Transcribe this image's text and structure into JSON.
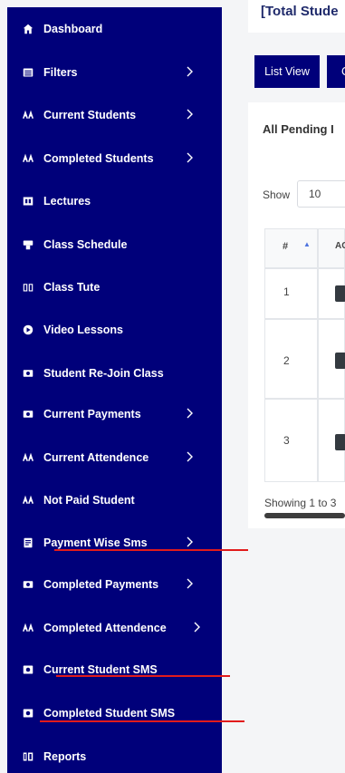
{
  "sidebar": {
    "items": [
      {
        "label": "Dashboard",
        "icon": "home-icon",
        "chevron": false
      },
      {
        "label": "Filters",
        "icon": "list-icon",
        "chevron": true
      },
      {
        "label": "Current Students",
        "icon": "users-icon",
        "chevron": true
      },
      {
        "label": "Completed Students",
        "icon": "users-icon",
        "chevron": true
      },
      {
        "label": "Lectures",
        "icon": "chalkboard-icon",
        "chevron": false
      },
      {
        "label": "Class Schedule",
        "icon": "schedule-icon",
        "chevron": false
      },
      {
        "label": "Class Tute",
        "icon": "book-icon",
        "chevron": false
      },
      {
        "label": "Video Lessons",
        "icon": "play-icon",
        "chevron": false
      },
      {
        "label": "Student Re-Join Class",
        "icon": "money-icon",
        "chevron": false
      },
      {
        "label": "Current Payments",
        "icon": "money-icon",
        "chevron": true
      },
      {
        "label": "Current Attendence",
        "icon": "users-icon",
        "chevron": true
      },
      {
        "label": "Not Paid Student",
        "icon": "users-icon",
        "chevron": false
      },
      {
        "label": "Payment Wise Sms",
        "icon": "message-icon",
        "chevron": true
      },
      {
        "label": "Completed Payments",
        "icon": "money-icon",
        "chevron": true
      },
      {
        "label": "Completed Attendence",
        "icon": "users-icon",
        "chevron": true
      },
      {
        "label": "Current Student SMS",
        "icon": "sms-icon",
        "chevron": false
      },
      {
        "label": "Completed Student SMS",
        "icon": "sms-icon",
        "chevron": false
      },
      {
        "label": "Reports",
        "icon": "reports-icon",
        "chevron": false
      }
    ]
  },
  "header": {
    "title": "[Total Stude"
  },
  "buttons": {
    "list_view": "List View",
    "second": "C"
  },
  "table_card": {
    "title": "All Pending I",
    "show_label": "Show",
    "page_size": "10",
    "columns": [
      "#",
      "AC"
    ],
    "rows": [
      {
        "num": "1"
      },
      {
        "num": "2"
      },
      {
        "num": "3"
      }
    ],
    "footer": "Showing 1 to 3"
  },
  "colors": {
    "sidebar": "#00007a",
    "annotation": "#e11b1b"
  }
}
